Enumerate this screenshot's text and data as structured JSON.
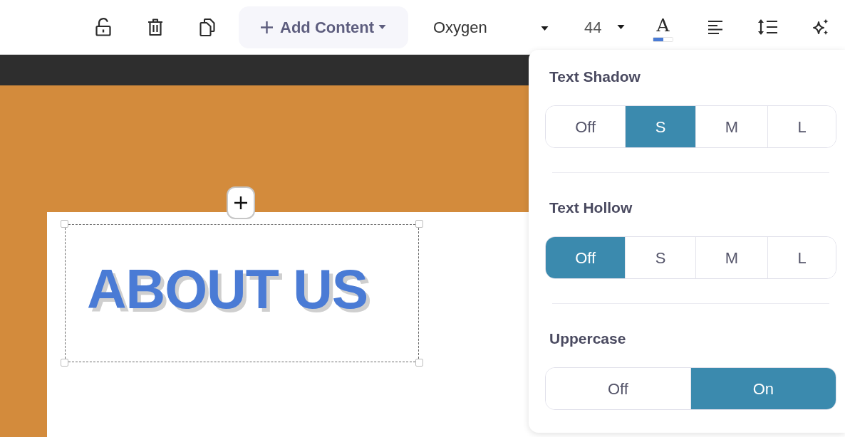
{
  "toolbar": {
    "add_content": "Add Content",
    "font": "Oxygen",
    "font_size": "44",
    "text_color_glyph": "A"
  },
  "canvas": {
    "heading": "ABOUT US"
  },
  "text_panel": {
    "sections": [
      {
        "label": "Text Shadow",
        "options": [
          {
            "label": "Off",
            "selected": false
          },
          {
            "label": "S",
            "selected": true
          },
          {
            "label": "M",
            "selected": false
          },
          {
            "label": "L",
            "selected": false
          }
        ]
      },
      {
        "label": "Text Hollow",
        "options": [
          {
            "label": "Off",
            "selected": true
          },
          {
            "label": "S",
            "selected": false
          },
          {
            "label": "M",
            "selected": false
          },
          {
            "label": "L",
            "selected": false
          }
        ]
      },
      {
        "label": "Uppercase",
        "options": [
          {
            "label": "Off",
            "selected": false
          },
          {
            "label": "On",
            "selected": true
          }
        ]
      }
    ]
  }
}
